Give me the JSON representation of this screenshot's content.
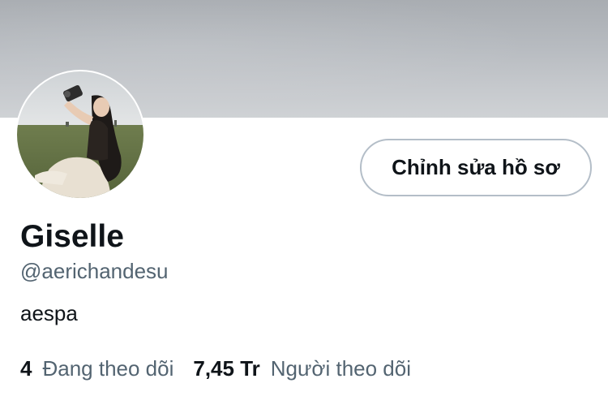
{
  "profile": {
    "display_name": "Giselle",
    "handle": "@aerichandesu",
    "bio": "aespa",
    "edit_button_label": "Chỉnh sửa hồ sơ"
  },
  "stats": {
    "following_count": "4",
    "following_label": "Đang theo dõi",
    "followers_count": "7,45 Tr",
    "followers_label": "Người theo dõi"
  },
  "colors": {
    "text_primary": "#0f1419",
    "text_secondary": "#536471",
    "button_border": "#b4bec8",
    "banner": "#b7bbc0"
  },
  "images": {
    "banner": "overcast gray sky",
    "avatar": "woman sitting in grass field holding a camera"
  }
}
